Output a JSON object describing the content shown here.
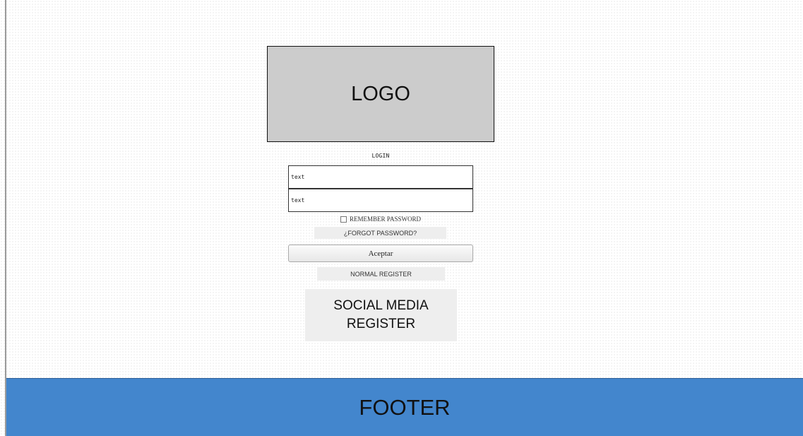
{
  "logo": {
    "label": "LOGO"
  },
  "login": {
    "title": "LOGIN",
    "username": {
      "value": "text"
    },
    "password": {
      "value": "text"
    },
    "remember_label": "REMEMBER PASSWORD",
    "remember_checked": false,
    "forgot_label": "¿FORGOT PASSWORD?",
    "accept_label": "Aceptar"
  },
  "register": {
    "normal_label": "NORMAL REGISTER",
    "social_label": "SOCIAL MEDIA\nREGISTER"
  },
  "footer": {
    "label": "FOOTER"
  },
  "colors": {
    "footer_bg": "#4386cd",
    "logo_bg": "#cccccc",
    "button_bg": "#eeeeee"
  }
}
